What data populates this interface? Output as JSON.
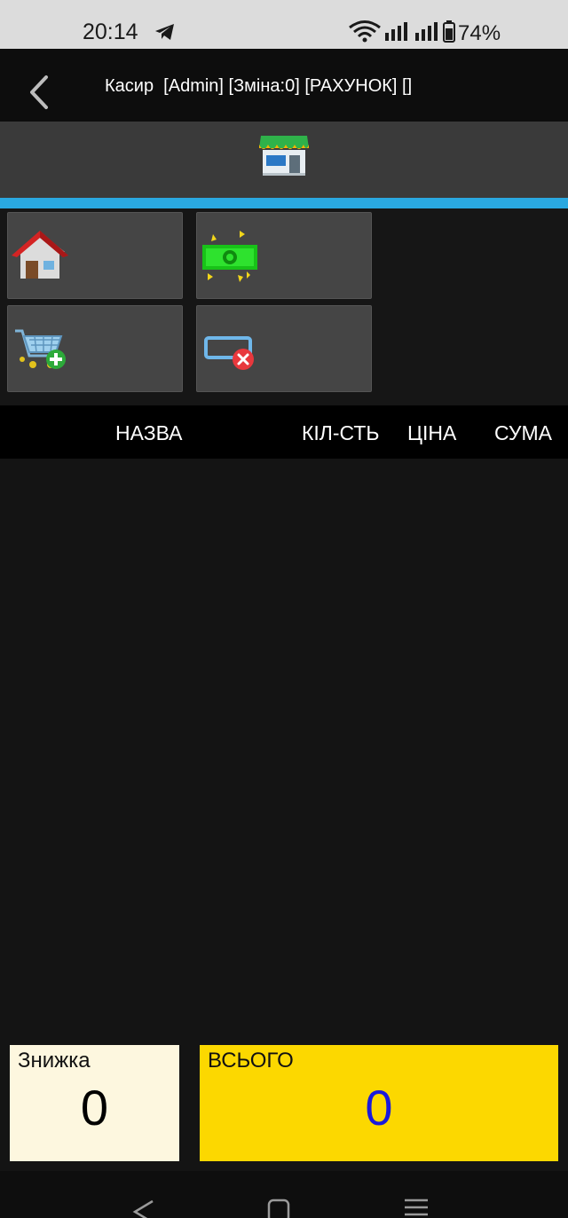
{
  "status_bar": {
    "time": "20:14",
    "battery": "74%"
  },
  "app_bar": {
    "title": "Касир  [Admin] [Зміна:0] [РАХУНОК] []"
  },
  "tools": [
    {
      "name": "home-button",
      "icon": "house-icon"
    },
    {
      "name": "payment-button",
      "icon": "money-icon"
    },
    {
      "name": "add-to-cart-button",
      "icon": "cart-add-icon"
    },
    {
      "name": "delete-receipt-button",
      "icon": "delete-field-icon"
    }
  ],
  "table": {
    "columns": {
      "name": "НАЗВА",
      "qty": "КІЛ-СТЬ",
      "price": "ЦІНА",
      "sum": "СУМА"
    },
    "rows": []
  },
  "summary": {
    "discount_label": "Знижка",
    "discount_value": "0",
    "total_label": "ВСЬОГО",
    "total_value": "0"
  },
  "colors": {
    "accent": "#2aa8e0",
    "discount_bg": "#fdf7df",
    "total_bg": "#fcd800",
    "total_value": "#1a1adb"
  }
}
